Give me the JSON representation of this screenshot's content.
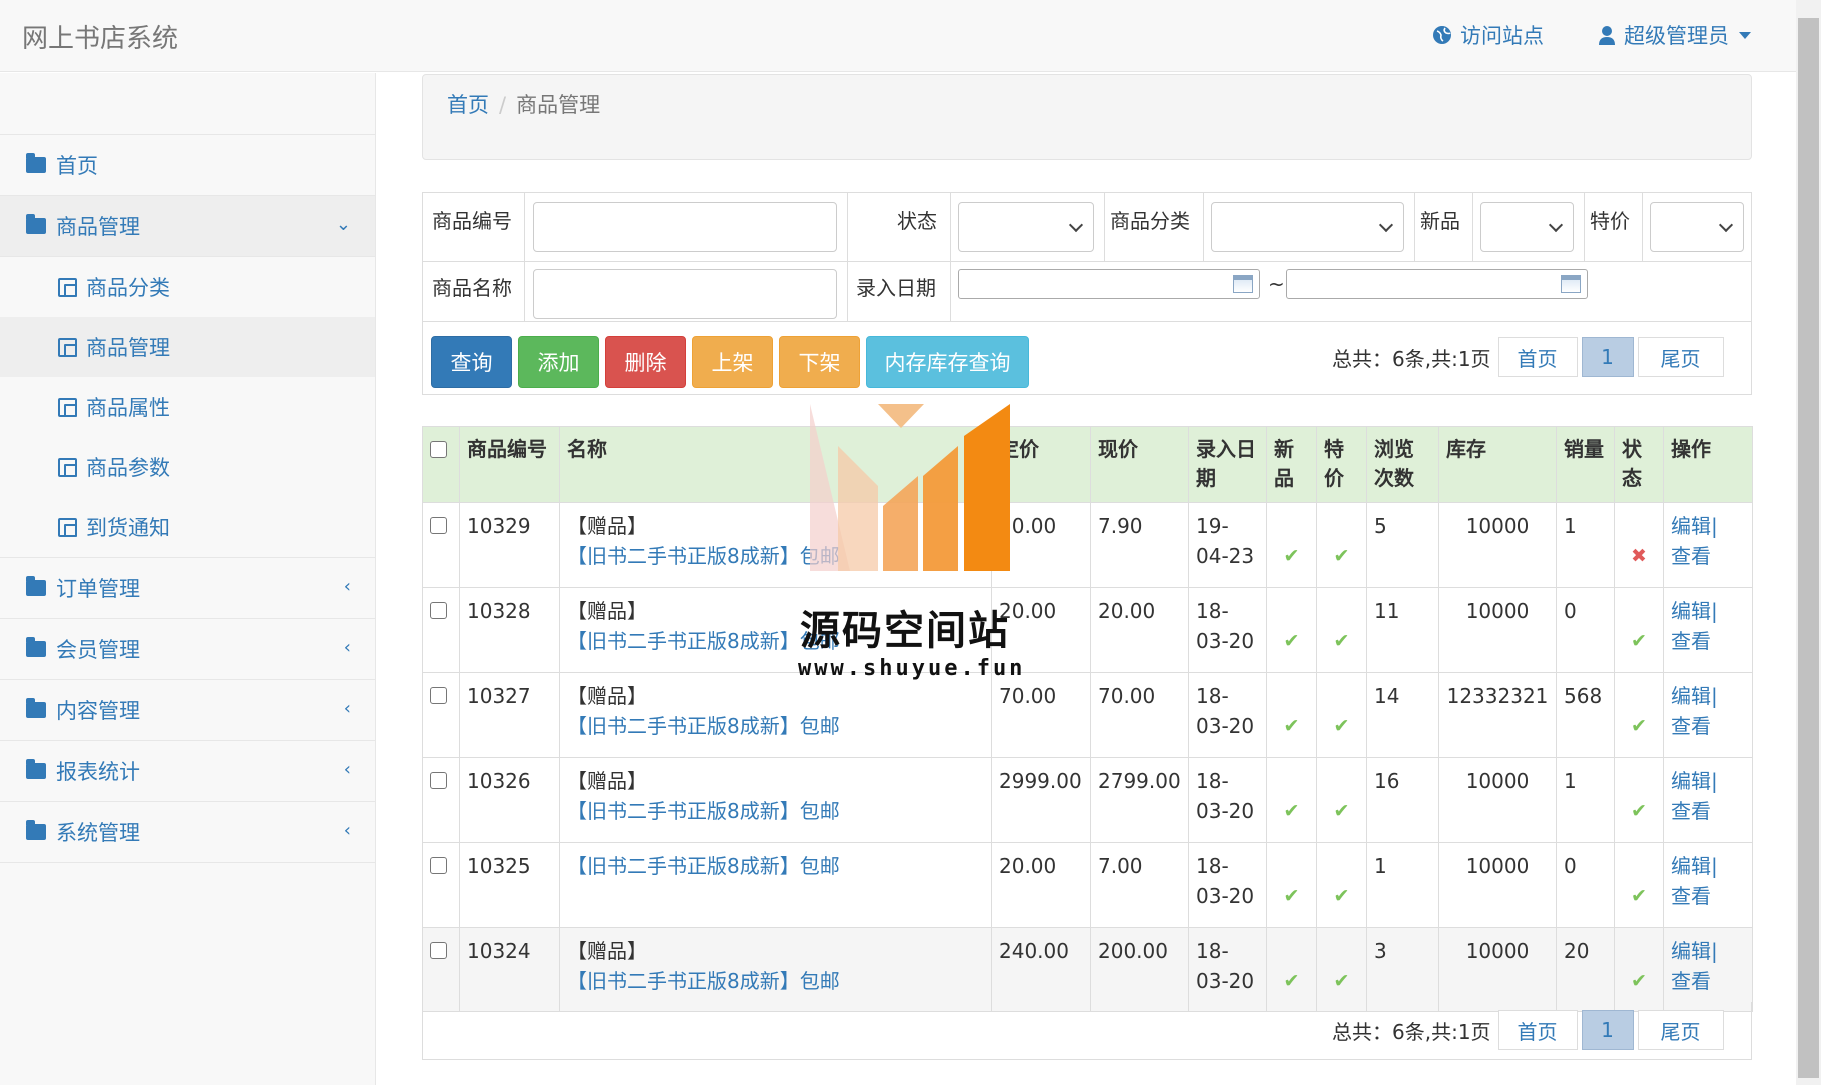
{
  "app": {
    "title": "网上书店系统",
    "visit_site": "访问站点",
    "user": "超级管理员"
  },
  "sidebar": {
    "items": [
      {
        "label": "首页"
      },
      {
        "label": "商品管理",
        "arrow": "⌄",
        "expanded": true,
        "children": [
          {
            "label": "商品分类"
          },
          {
            "label": "商品管理"
          },
          {
            "label": "商品属性"
          },
          {
            "label": "商品参数"
          },
          {
            "label": "到货通知"
          }
        ]
      },
      {
        "label": "订单管理",
        "arrow": "‹"
      },
      {
        "label": "会员管理",
        "arrow": "‹"
      },
      {
        "label": "内容管理",
        "arrow": "‹"
      },
      {
        "label": "报表统计",
        "arrow": "‹"
      },
      {
        "label": "系统管理",
        "arrow": "‹"
      }
    ]
  },
  "breadcrumb": {
    "home": "首页",
    "sep": "/",
    "current": "商品管理"
  },
  "form": {
    "product_no_label": "商品编号",
    "product_no": "",
    "status_label": "状态",
    "status": "",
    "category_label": "商品分类",
    "category": "",
    "new_label": "新品",
    "new": "",
    "special_label": "特价",
    "special": "",
    "name_label": "商品名称",
    "name": "",
    "date_label": "录入日期",
    "date_from": "",
    "date_to": "",
    "tilde": "~"
  },
  "buttons": {
    "query": "查询",
    "add": "添加",
    "delete": "删除",
    "on_shelf": "上架",
    "off_shelf": "下架",
    "stock_query": "内存库存查询"
  },
  "pager": {
    "total": "总共：6条,共:1页",
    "first": "首页",
    "current": "1",
    "last": "尾页"
  },
  "table": {
    "headers": {
      "no": "商品编号",
      "name": "名称",
      "list_price": "定价",
      "price": "现价",
      "date": "录入日期",
      "new": "新品",
      "special": "特价",
      "views": "浏览次数",
      "stock": "库存",
      "sales": "销量",
      "status": "状态",
      "ops": "操作"
    },
    "gift": "【赠品】",
    "edit": "编辑|",
    "view": "查看",
    "rows": [
      {
        "no": "10329",
        "gift": true,
        "title": "【旧书二手书正版8成新】包邮",
        "list_price": "20.00",
        "price": "7.90",
        "date": "19-04-23",
        "new": true,
        "special": true,
        "views": "5",
        "stock": "10000",
        "sales": "1",
        "status": false
      },
      {
        "no": "10328",
        "gift": true,
        "title": "【旧书二手书正版8成新】包邮",
        "list_price": "20.00",
        "price": "20.00",
        "date": "18-03-20",
        "new": true,
        "special": true,
        "views": "11",
        "stock": "10000",
        "sales": "0",
        "status": true
      },
      {
        "no": "10327",
        "gift": true,
        "title": "【旧书二手书正版8成新】包邮",
        "list_price": "70.00",
        "price": "70.00",
        "date": "18-03-20",
        "new": true,
        "special": true,
        "views": "14",
        "stock": "12332321",
        "sales": "568",
        "status": true
      },
      {
        "no": "10326",
        "gift": true,
        "title": "【旧书二手书正版8成新】包邮",
        "list_price": "2999.00",
        "price": "2799.00",
        "date": "18-03-20",
        "new": true,
        "special": true,
        "views": "16",
        "stock": "10000",
        "sales": "1",
        "status": true
      },
      {
        "no": "10325",
        "gift": false,
        "title": "【旧书二手书正版8成新】包邮",
        "list_price": "20.00",
        "price": "7.00",
        "date": "18-03-20",
        "new": true,
        "special": true,
        "views": "1",
        "stock": "10000",
        "sales": "0",
        "status": true
      },
      {
        "no": "10324",
        "gift": true,
        "title": "【旧书二手书正版8成新】包邮",
        "list_price": "240.00",
        "price": "200.00",
        "date": "18-03-20",
        "new": true,
        "special": true,
        "views": "3",
        "stock": "10000",
        "sales": "20",
        "status": true
      }
    ]
  },
  "watermark": {
    "title": "源码空间站",
    "url": "www.shuyue.fun"
  },
  "colors": {
    "primary": "#337ab7",
    "success": "#5cb85c",
    "danger": "#d9534f",
    "warning": "#f0ad4e",
    "info": "#5bc0de",
    "header_bg": "#dff0d8",
    "check": "#7dc35b",
    "cross": "#e05a5a"
  }
}
